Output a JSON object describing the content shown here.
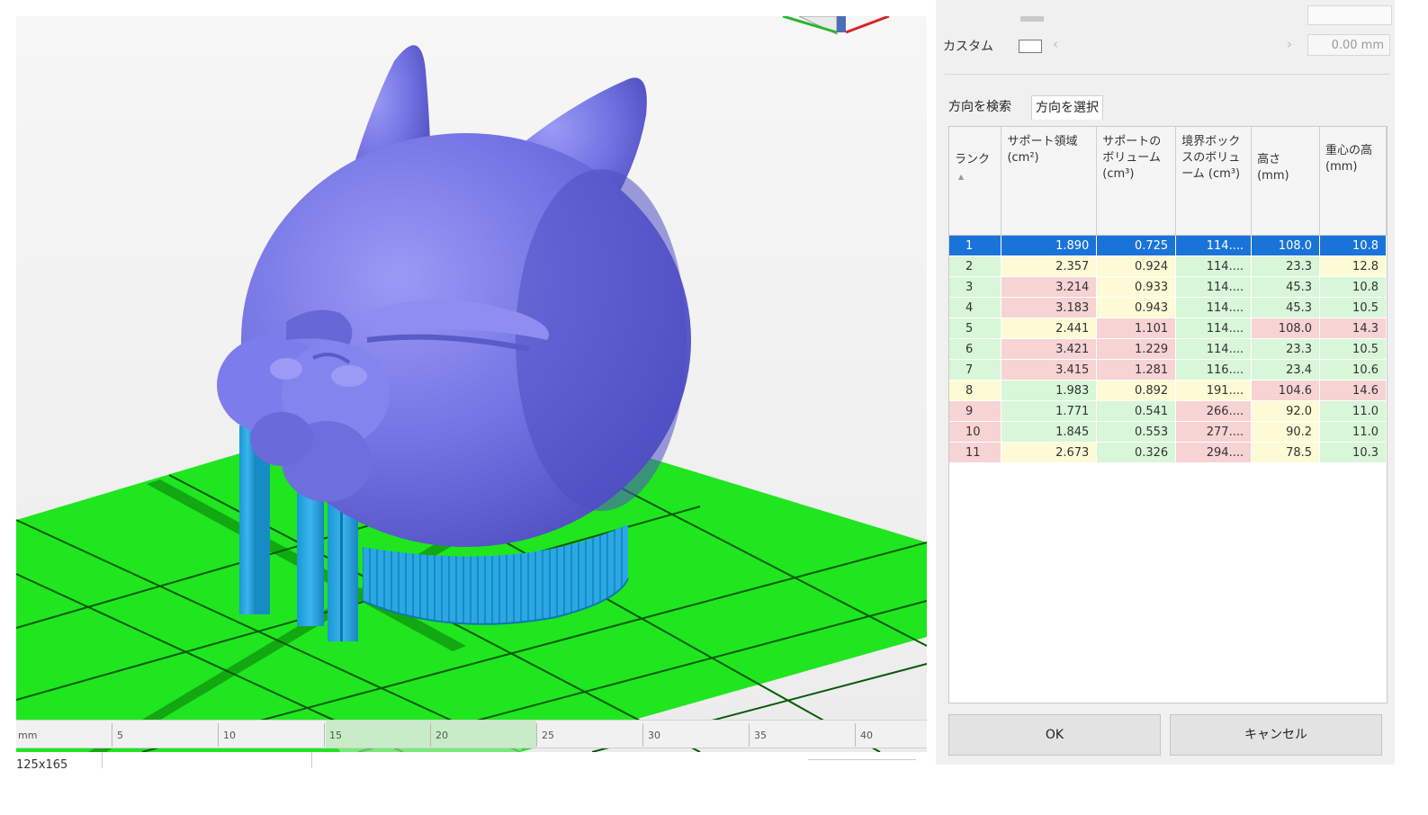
{
  "viewport": {
    "ruler_labels": [
      "5",
      "10",
      "15",
      "20",
      "25",
      "30",
      "35",
      "40"
    ],
    "ruler_left_label": "mm",
    "status_size": "125x165"
  },
  "panel": {
    "custom_label": "カスタム",
    "custom_value": "0.00 mm",
    "tabs": [
      {
        "label": "方向を検索",
        "active": false
      },
      {
        "label": "方向を選択",
        "active": true
      }
    ],
    "table": {
      "columns": [
        "ランク",
        "サポート領域 (cm²)",
        "サポートのボリューム (cm³)",
        "境界ボックスのボリューム (cm³)",
        "高さ (mm)",
        "重心の高 (mm)"
      ],
      "sort_indicator": "▲",
      "rows": [
        {
          "rank": "1",
          "area": "1.890",
          "volume": "0.725",
          "bbox": "114....",
          "height": "108.0",
          "cog": "10.8",
          "selected": true,
          "colors": [
            "g",
            "g",
            "g",
            "g",
            "g",
            "g"
          ]
        },
        {
          "rank": "2",
          "area": "2.357",
          "volume": "0.924",
          "bbox": "114....",
          "height": "23.3",
          "cog": "12.8",
          "colors": [
            "g",
            "y",
            "y",
            "g",
            "g",
            "y"
          ]
        },
        {
          "rank": "3",
          "area": "3.214",
          "volume": "0.933",
          "bbox": "114....",
          "height": "45.3",
          "cog": "10.8",
          "colors": [
            "g",
            "r",
            "y",
            "g",
            "g",
            "g"
          ]
        },
        {
          "rank": "4",
          "area": "3.183",
          "volume": "0.943",
          "bbox": "114....",
          "height": "45.3",
          "cog": "10.5",
          "colors": [
            "g",
            "r",
            "y",
            "g",
            "g",
            "g"
          ]
        },
        {
          "rank": "5",
          "area": "2.441",
          "volume": "1.101",
          "bbox": "114....",
          "height": "108.0",
          "cog": "14.3",
          "colors": [
            "g",
            "y",
            "r",
            "g",
            "r",
            "r"
          ]
        },
        {
          "rank": "6",
          "area": "3.421",
          "volume": "1.229",
          "bbox": "114....",
          "height": "23.3",
          "cog": "10.5",
          "colors": [
            "g",
            "r",
            "r",
            "g",
            "g",
            "g"
          ]
        },
        {
          "rank": "7",
          "area": "3.415",
          "volume": "1.281",
          "bbox": "116....",
          "height": "23.4",
          "cog": "10.6",
          "colors": [
            "g",
            "r",
            "r",
            "g",
            "g",
            "g"
          ]
        },
        {
          "rank": "8",
          "area": "1.983",
          "volume": "0.892",
          "bbox": "191....",
          "height": "104.6",
          "cog": "14.6",
          "colors": [
            "y",
            "g",
            "y",
            "y",
            "r",
            "r"
          ]
        },
        {
          "rank": "9",
          "area": "1.771",
          "volume": "0.541",
          "bbox": "266....",
          "height": "92.0",
          "cog": "11.0",
          "colors": [
            "r",
            "g",
            "g",
            "r",
            "y",
            "g"
          ]
        },
        {
          "rank": "10",
          "area": "1.845",
          "volume": "0.553",
          "bbox": "277....",
          "height": "90.2",
          "cog": "11.0",
          "colors": [
            "r",
            "g",
            "g",
            "r",
            "y",
            "g"
          ]
        },
        {
          "rank": "11",
          "area": "2.673",
          "volume": "0.326",
          "bbox": "294....",
          "height": "78.5",
          "cog": "10.3",
          "colors": [
            "r",
            "y",
            "g",
            "r",
            "y",
            "g"
          ]
        }
      ]
    },
    "ok_label": "OK",
    "cancel_label": "キャンセル"
  }
}
